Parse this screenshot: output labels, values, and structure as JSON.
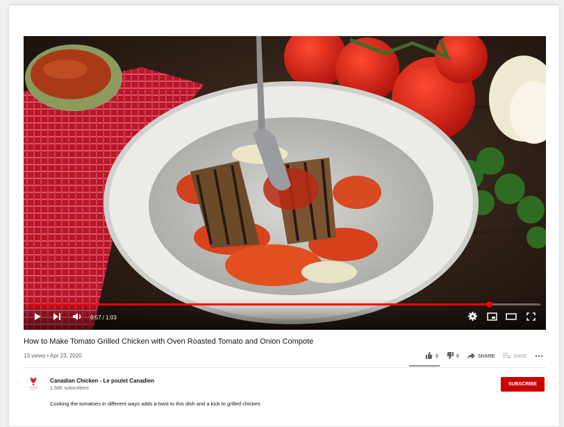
{
  "player": {
    "time": "0:57 / 1:03",
    "progress": 0.9,
    "icons": {
      "play": "play-icon",
      "next": "next-icon",
      "volume": "volume-icon",
      "settings": "gear-icon",
      "miniplayer": "miniplayer-icon",
      "theater": "theater-icon",
      "fullscreen": "fullscreen-icon"
    }
  },
  "video": {
    "title": "How to Make Tomato Grilled Chicken with Oven Roasted Tomato and Onion Compote",
    "meta": "13 views • Apr 23, 2020"
  },
  "actions": {
    "like_count": "0",
    "dislike_count": "0",
    "share_label": "SHARE",
    "save_label": "SAVE"
  },
  "channel": {
    "name": "Canadian Chicken - Le poulet Canadien",
    "subscribers": "1.58K subscribers",
    "subscribe_label": "SUBSCRIBE"
  },
  "description": "Cooking the tomatoes in different ways adds a twist to this dish and a kick to grilled chicken.",
  "colors": {
    "accent": "#cc0000",
    "progress": "#ff0000"
  }
}
